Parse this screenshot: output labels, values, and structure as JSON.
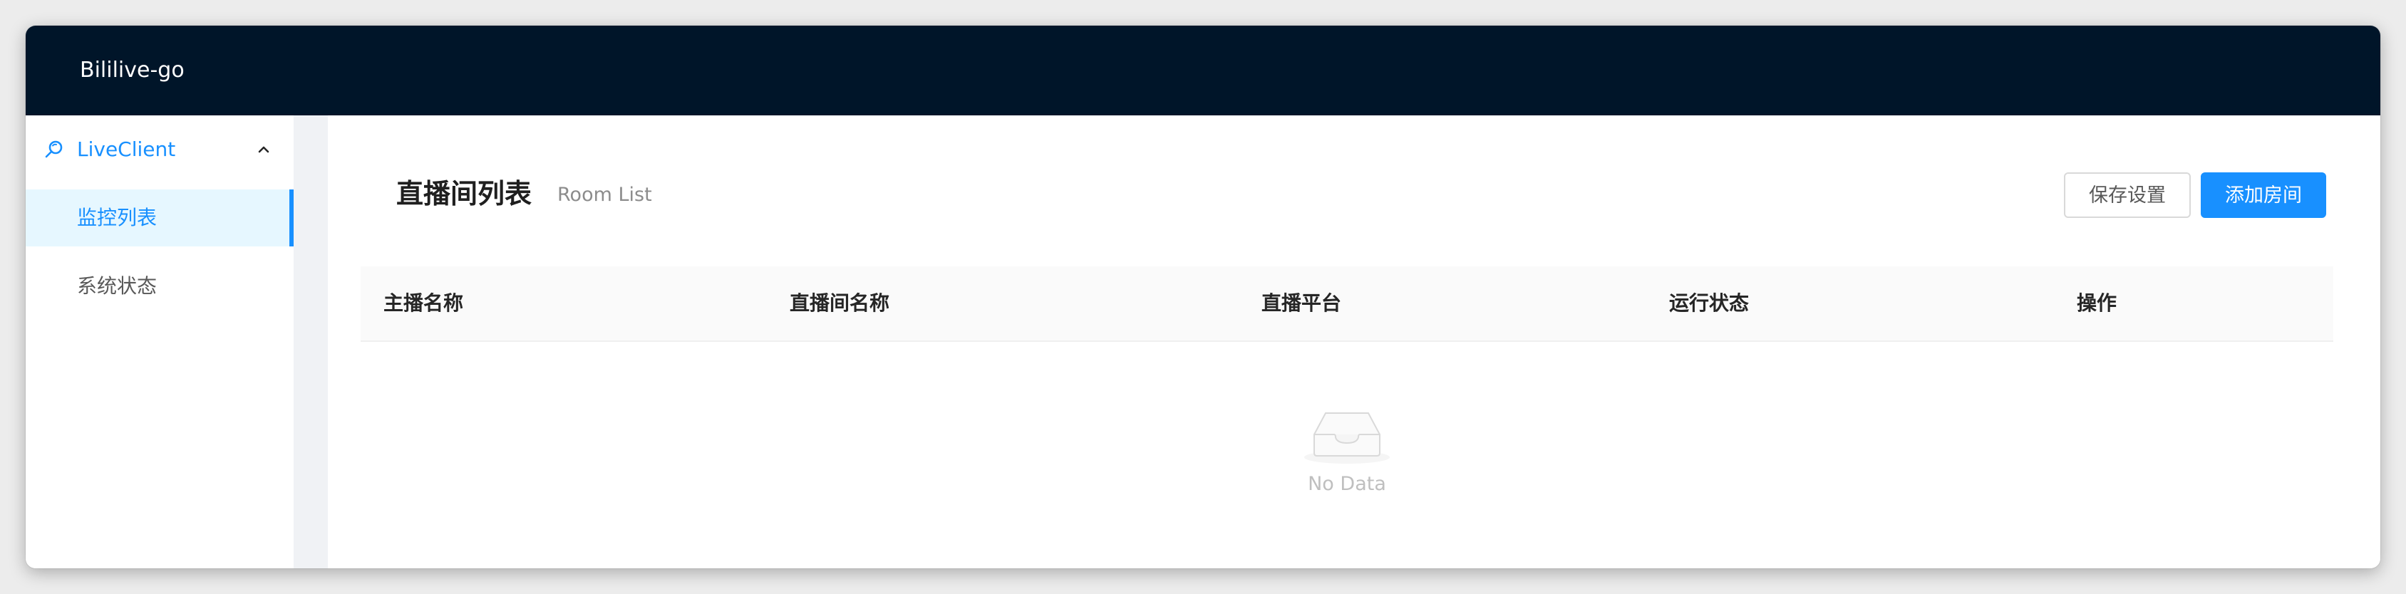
{
  "header": {
    "title": "Bililive-go"
  },
  "sidebar": {
    "group": {
      "label": "LiveClient",
      "icon": "search-icon",
      "expanded": true
    },
    "items": [
      {
        "label": "监控列表",
        "active": true
      },
      {
        "label": "系统状态",
        "active": false
      }
    ]
  },
  "page": {
    "title": "直播间列表",
    "subtitle": "Room List",
    "buttons": {
      "save": "保存设置",
      "add": "添加房间"
    }
  },
  "table": {
    "columns": [
      "主播名称",
      "直播间名称",
      "直播平台",
      "运行状态",
      "操作"
    ],
    "rows": [],
    "empty_text": "No Data"
  },
  "colors": {
    "header_bg": "#001529",
    "accent": "#1890ff",
    "active_bg": "#e6f7ff",
    "layout_bg": "#f0f2f5"
  }
}
